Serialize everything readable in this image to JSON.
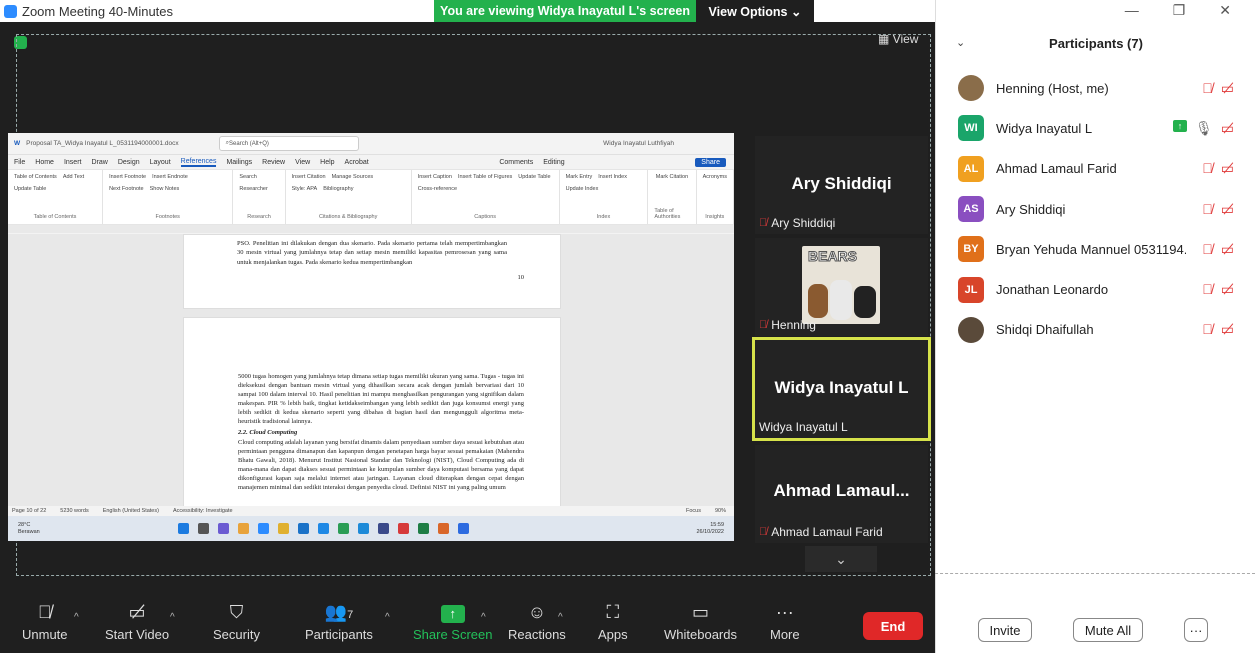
{
  "window": {
    "title": "Zoom Meeting 40-Minutes"
  },
  "banner": {
    "viewing": "You are viewing Widya Inayatul L's screen",
    "view_options": "View Options ⌄"
  },
  "view_toggle": "View",
  "word": {
    "doc_title": "Proposal TA_Widya Inayatul L_0531194000001.docx",
    "search": "Search (Alt+Q)",
    "user": "Widya Inayatul Luthfiyah",
    "tabs": [
      "File",
      "Home",
      "Insert",
      "Draw",
      "Design",
      "Layout",
      "References",
      "Mailings",
      "Review",
      "View",
      "Help",
      "Acrobat"
    ],
    "comments": "Comments",
    "editing": "Editing",
    "share": "Share",
    "ribbon": [
      {
        "items": [
          "Table of Contents",
          "Add Text",
          "Update Table"
        ],
        "group": "Table of Contents"
      },
      {
        "items": [
          "Insert Footnote",
          "Insert Endnote",
          "Next Footnote",
          "Show Notes"
        ],
        "group": "Footnotes"
      },
      {
        "items": [
          "Search",
          "Researcher"
        ],
        "group": "Research"
      },
      {
        "items": [
          "Insert Citation",
          "Manage Sources",
          "Style: APA",
          "Bibliography"
        ],
        "group": "Citations & Bibliography"
      },
      {
        "items": [
          "Insert Caption",
          "Insert Table of Figures",
          "Update Table",
          "Cross-reference"
        ],
        "group": "Captions"
      },
      {
        "items": [
          "Mark Entry",
          "Insert Index",
          "Update Index"
        ],
        "group": "Index"
      },
      {
        "items": [
          "Mark Citation"
        ],
        "group": "Table of Authorities"
      },
      {
        "items": [
          "Acronyms"
        ],
        "group": "Insights"
      }
    ],
    "page1_text": "PSO. Penelitian ini dilakukan dengan dua skenario. Pada skenario pertama telah mempertimbangkan 30 mesin virtual yang jumlahnya tetap dan setiap mesin memiliki kapasitas pemrosesan yang sama untuk menjalankan tugas. Pada skenario kedua mempertimbangkan",
    "page1_num": "10",
    "page2_p1": "5000 tugas homogen yang jumlahnya tetap dimana setiap tugas memiliki ukuran yang sama. Tugas - tugas ini dieksekusi dengan bantuan mesin virtual yang dihasilkan secara acak dengan jumlah bervariasi dari 10 sampai 100 dalam interval 10. Hasil penelitian ini mampu menghasilkan pengurangan yang signifikan dalam makespan. PIR % lebih baik, tingkat ketidakseimbangan yang lebih sedikit dan juga konsumsi energi yang lebih sedikit di kedua skenario seperti yang dibahas di bagian hasil dan mengungguli algoritma meta-heuristik tradisional lainnya.",
    "page2_heading": "2.2.      Cloud Computing",
    "page2_p2": "Cloud computing adalah layanan yang bersifat dinamis dalam penyediaan sumber daya sesuai kebutuhan atau permintaan pengguna dimanapun dan kapanpun dengan penetapan harga bayar sesuai pemakaian (Mahendra Bhatu Gawali, 2018). Menurut Institut Nasional Standar dan Teknologi (NIST), Cloud Computing ada di mana-mana dan dapat diakses sesuai permintaan ke kumpulan sumber daya komputasi bersama yang dapat dikonfigurasi kapan saja melalui internet atau jaringan. Layanan cloud diterapkan dengan cepat dengan manajemen minimal dan sedikit interaksi dengan penyedia cloud. Definisi NIST ini yang paling umum",
    "status": [
      "Page 10 of 22",
      "5230 words",
      "English (United States)",
      "Accessibility: Investigate",
      "Focus",
      "90%"
    ],
    "weather": {
      "temp": "28°C",
      "desc": "Berawan"
    },
    "clock": {
      "time": "15:59",
      "date": "26/10/2022"
    }
  },
  "tiles": [
    {
      "big": "Ary Shiddiqi",
      "name": "Ary Shiddiqi"
    },
    {
      "big": "",
      "name": "Henning",
      "image_text": "BEARS"
    },
    {
      "big": "Widya Inayatul L",
      "name": "Widya Inayatul L"
    },
    {
      "big": "Ahmad  Lamaul...",
      "name": "Ahmad Lamaul Farid"
    }
  ],
  "toolbar": {
    "unmute": "Unmute",
    "start_video": "Start Video",
    "security": "Security",
    "participants": "Participants",
    "participants_count": "7",
    "share_screen": "Share Screen",
    "reactions": "Reactions",
    "apps": "Apps",
    "whiteboards": "Whiteboards",
    "more": "More",
    "end": "End"
  },
  "panel": {
    "title": "Participants (7)",
    "participants": [
      {
        "initials": "",
        "name": "Henning (Host, me)",
        "color": "#8a6d4a"
      },
      {
        "initials": "WI",
        "name": "Widya Inayatul L",
        "color": "#1aa56a"
      },
      {
        "initials": "AL",
        "name": "Ahmad Lamaul Farid",
        "color": "#f0a020"
      },
      {
        "initials": "AS",
        "name": "Ary Shiddiqi",
        "color": "#8a4fc0"
      },
      {
        "initials": "BY",
        "name": "Bryan Yehuda Mannuel 0531194...",
        "color": "#e0701a"
      },
      {
        "initials": "JL",
        "name": "Jonathan Leonardo",
        "color": "#d8452a"
      },
      {
        "initials": "",
        "name": "Shidqi Dhaifullah",
        "color": "#5a4a3a"
      }
    ],
    "invite": "Invite",
    "mute_all": "Mute All",
    "more": "···"
  },
  "colors": {
    "zoom_blue": "#2d8cff",
    "share_green": "#23b14d",
    "end_red": "#e02828",
    "highlight": "#d6e24a"
  }
}
